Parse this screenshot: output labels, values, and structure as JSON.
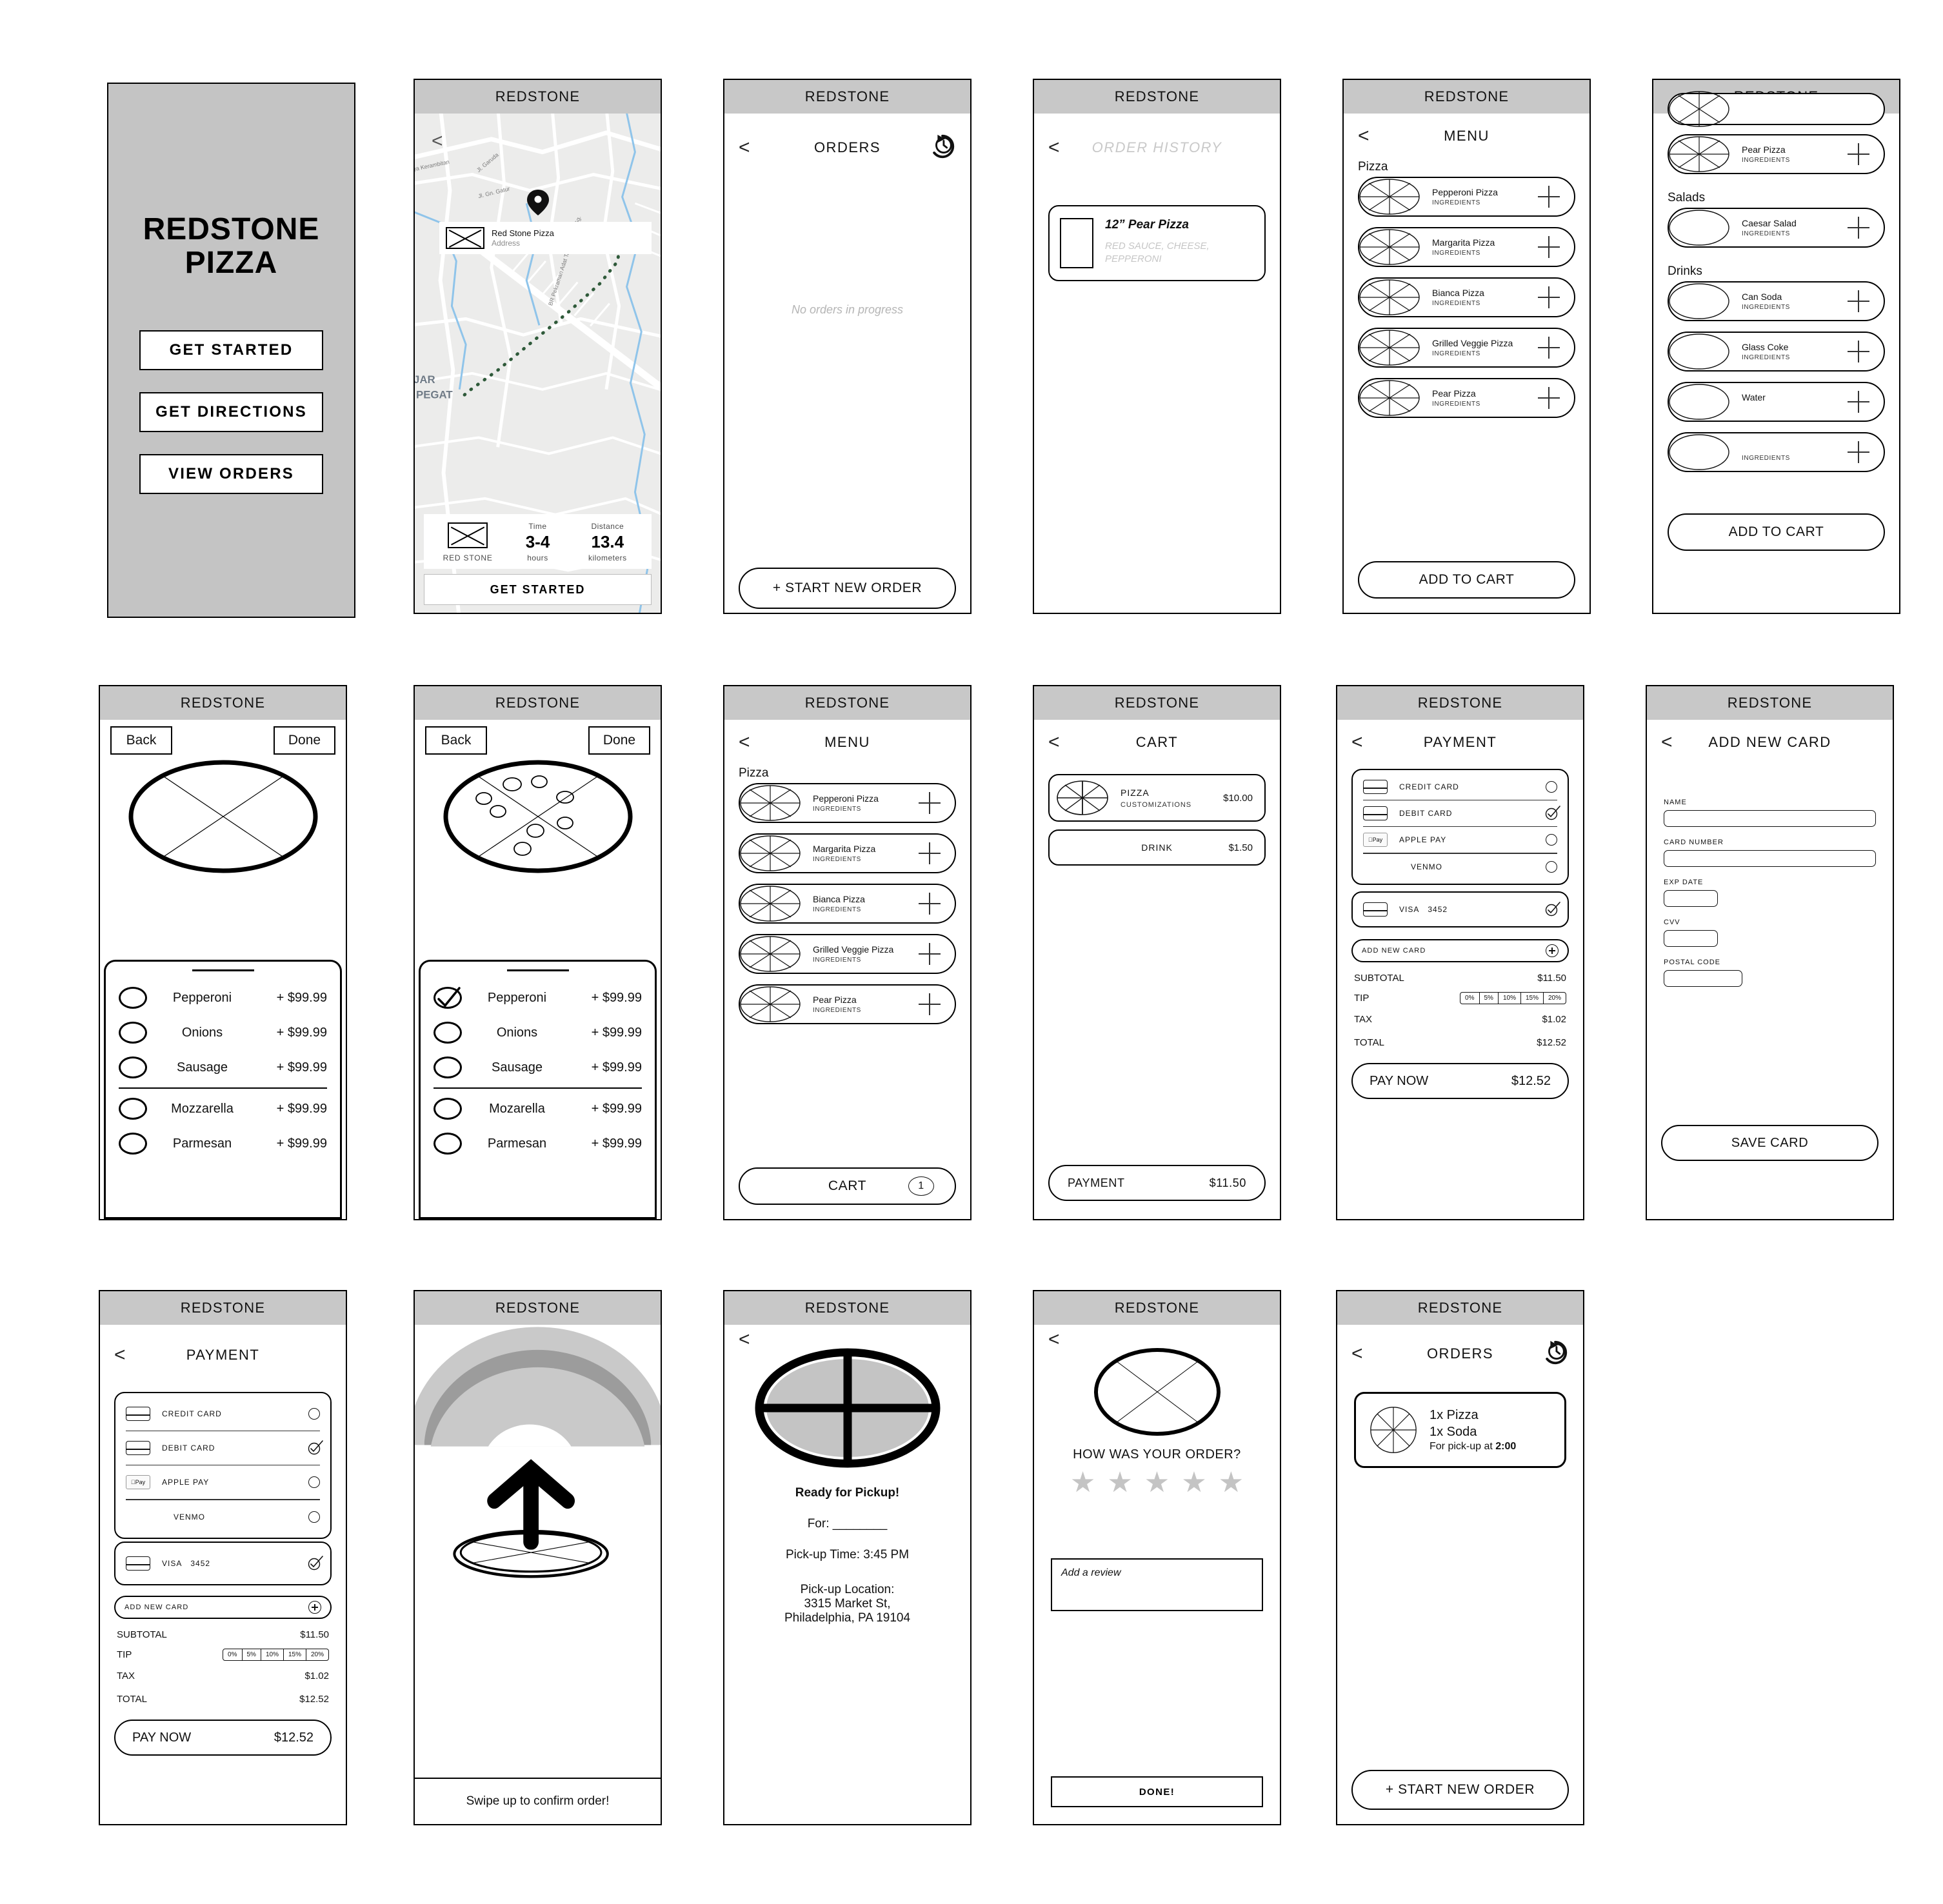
{
  "brand": "REDSTONE",
  "splash": {
    "title_line1": "REDSTONE",
    "title_line2": "PIZZA",
    "buttons": [
      "GET STARTED",
      "GET DIRECTIONS",
      "VIEW ORDERS"
    ]
  },
  "map": {
    "title": "REDSTONE",
    "place_name": "Red Stone Pizza",
    "place_address": "Address",
    "logo_label": "RED STONE",
    "time_label": "Time",
    "time_value": "3-4",
    "time_unit": "hours",
    "distance_label": "Distance",
    "distance_value": "13.4",
    "distance_unit": "kilometers",
    "cta": "GET STARTED",
    "street_labels": [
      "ya Kerambitan",
      "Jl. Garuda",
      "Jl. Gn. Gatur",
      "JAR",
      "PEGAT",
      "BR Pekraman Adat Tanah Pegat Gg."
    ]
  },
  "orders_empty": {
    "nav_title": "ORDERS",
    "empty_message": "No orders in progress",
    "cta": "+ START NEW ORDER"
  },
  "order_history": {
    "nav_title": "ORDER HISTORY",
    "item_title": "12” Pear Pizza",
    "item_desc": "RED SAUCE, CHEESE, PEPPERONI"
  },
  "menu": {
    "nav_title": "MENU",
    "section_pizza": "Pizza",
    "section_salads": "Salads",
    "section_drinks": "Drinks",
    "ingredients_label": "INGREDIENTS",
    "pizzas": [
      "Pepperoni Pizza",
      "Margarita Pizza",
      "Bianca Pizza",
      "Grilled Veggie Pizza",
      "Pear Pizza"
    ],
    "salads": [
      "Caesar Salad"
    ],
    "drinks": [
      "Can Soda",
      "Glass Coke",
      "Water"
    ],
    "add_to_cart": "ADD TO CART",
    "cart_label": "CART",
    "cart_count": "1"
  },
  "customize": {
    "back": "Back",
    "done": "Done",
    "toppings": [
      {
        "name": "Pepperoni",
        "price": "+ $99.99",
        "checked": false
      },
      {
        "name": "Onions",
        "price": "+ $99.99",
        "checked": false
      },
      {
        "name": "Sausage",
        "price": "+ $99.99",
        "checked": false
      }
    ],
    "cheeses": [
      {
        "name": "Mozzarella",
        "price": "+ $99.99",
        "checked": false
      },
      {
        "name": "Parmesan",
        "price": "+ $99.99",
        "checked": false
      }
    ],
    "toppings_selected": [
      {
        "name": "Pepperoni",
        "price": "+ $99.99",
        "checked": true
      },
      {
        "name": "Onions",
        "price": "+ $99.99",
        "checked": false
      },
      {
        "name": "Sausage",
        "price": "+ $99.99",
        "checked": false
      }
    ],
    "cheeses_selected": [
      {
        "name": "Mozarella",
        "price": "+ $99.99",
        "checked": false
      },
      {
        "name": "Parmesan",
        "price": "+ $99.99",
        "checked": false
      }
    ]
  },
  "cart": {
    "nav_title": "CART",
    "item1_name": "PIZZA",
    "item1_sub": "CUSTOMIZATIONS",
    "item1_price": "$10.00",
    "item2_name": "DRINK",
    "item2_price": "$1.50",
    "footer_label": "PAYMENT",
    "footer_price": "$11.50"
  },
  "payment": {
    "nav_title": "PAYMENT",
    "methods": [
      {
        "label": "CREDIT CARD",
        "icon": "card-icon",
        "selected": false
      },
      {
        "label": "DEBIT CARD",
        "icon": "card-icon",
        "selected": true
      },
      {
        "label": "APPLE PAY",
        "icon": "apple-pay-icon",
        "selected": false
      },
      {
        "label": "VENMO",
        "icon": "",
        "selected": false
      }
    ],
    "saved_card_brand": "VISA",
    "saved_card_last4": "3452",
    "add_new_card": "ADD NEW CARD",
    "subtotal_label": "SUBTOTAL",
    "subtotal_value": "$11.50",
    "tip_label": "TIP",
    "tip_options": [
      "0%",
      "5%",
      "10%",
      "15%",
      "20%"
    ],
    "tax_label": "TAX",
    "tax_value": "$1.02",
    "total_label": "TOTAL",
    "total_value": "$12.52",
    "pay_now_label": "PAY NOW",
    "pay_now_value": "$12.52"
  },
  "add_card": {
    "nav_title": "ADD NEW CARD",
    "fields": [
      "NAME",
      "CARD NUMBER",
      "EXP DATE",
      "CVV",
      "POSTAL CODE"
    ],
    "save_label": "SAVE CARD"
  },
  "swipe": {
    "caption": "Swipe up to confirm order!"
  },
  "ready": {
    "heading": "Ready for Pickup!",
    "for_label": "For: ________",
    "pickup_time": "Pick-up Time: 3:45 PM",
    "location_label": "Pick-up Location:",
    "location_line1": "3315 Market St,",
    "location_line2": "Philadelphia, PA 19104"
  },
  "review": {
    "question": "HOW WAS YOUR ORDER?",
    "star_count": 5,
    "placeholder": "Add a review",
    "done_label": "DONE!"
  },
  "orders_active": {
    "nav_title": "ORDERS",
    "line1": "1x Pizza",
    "line2": "1x Soda",
    "line3_prefix": "For pick-up at ",
    "line3_time": "2:00",
    "cta": "+ START NEW ORDER"
  },
  "colors": {
    "titlebar": "#c8c8c8",
    "splash_bg": "#c4c4c4",
    "muted": "#b5b5b5",
    "star": "#c4c4c4"
  }
}
